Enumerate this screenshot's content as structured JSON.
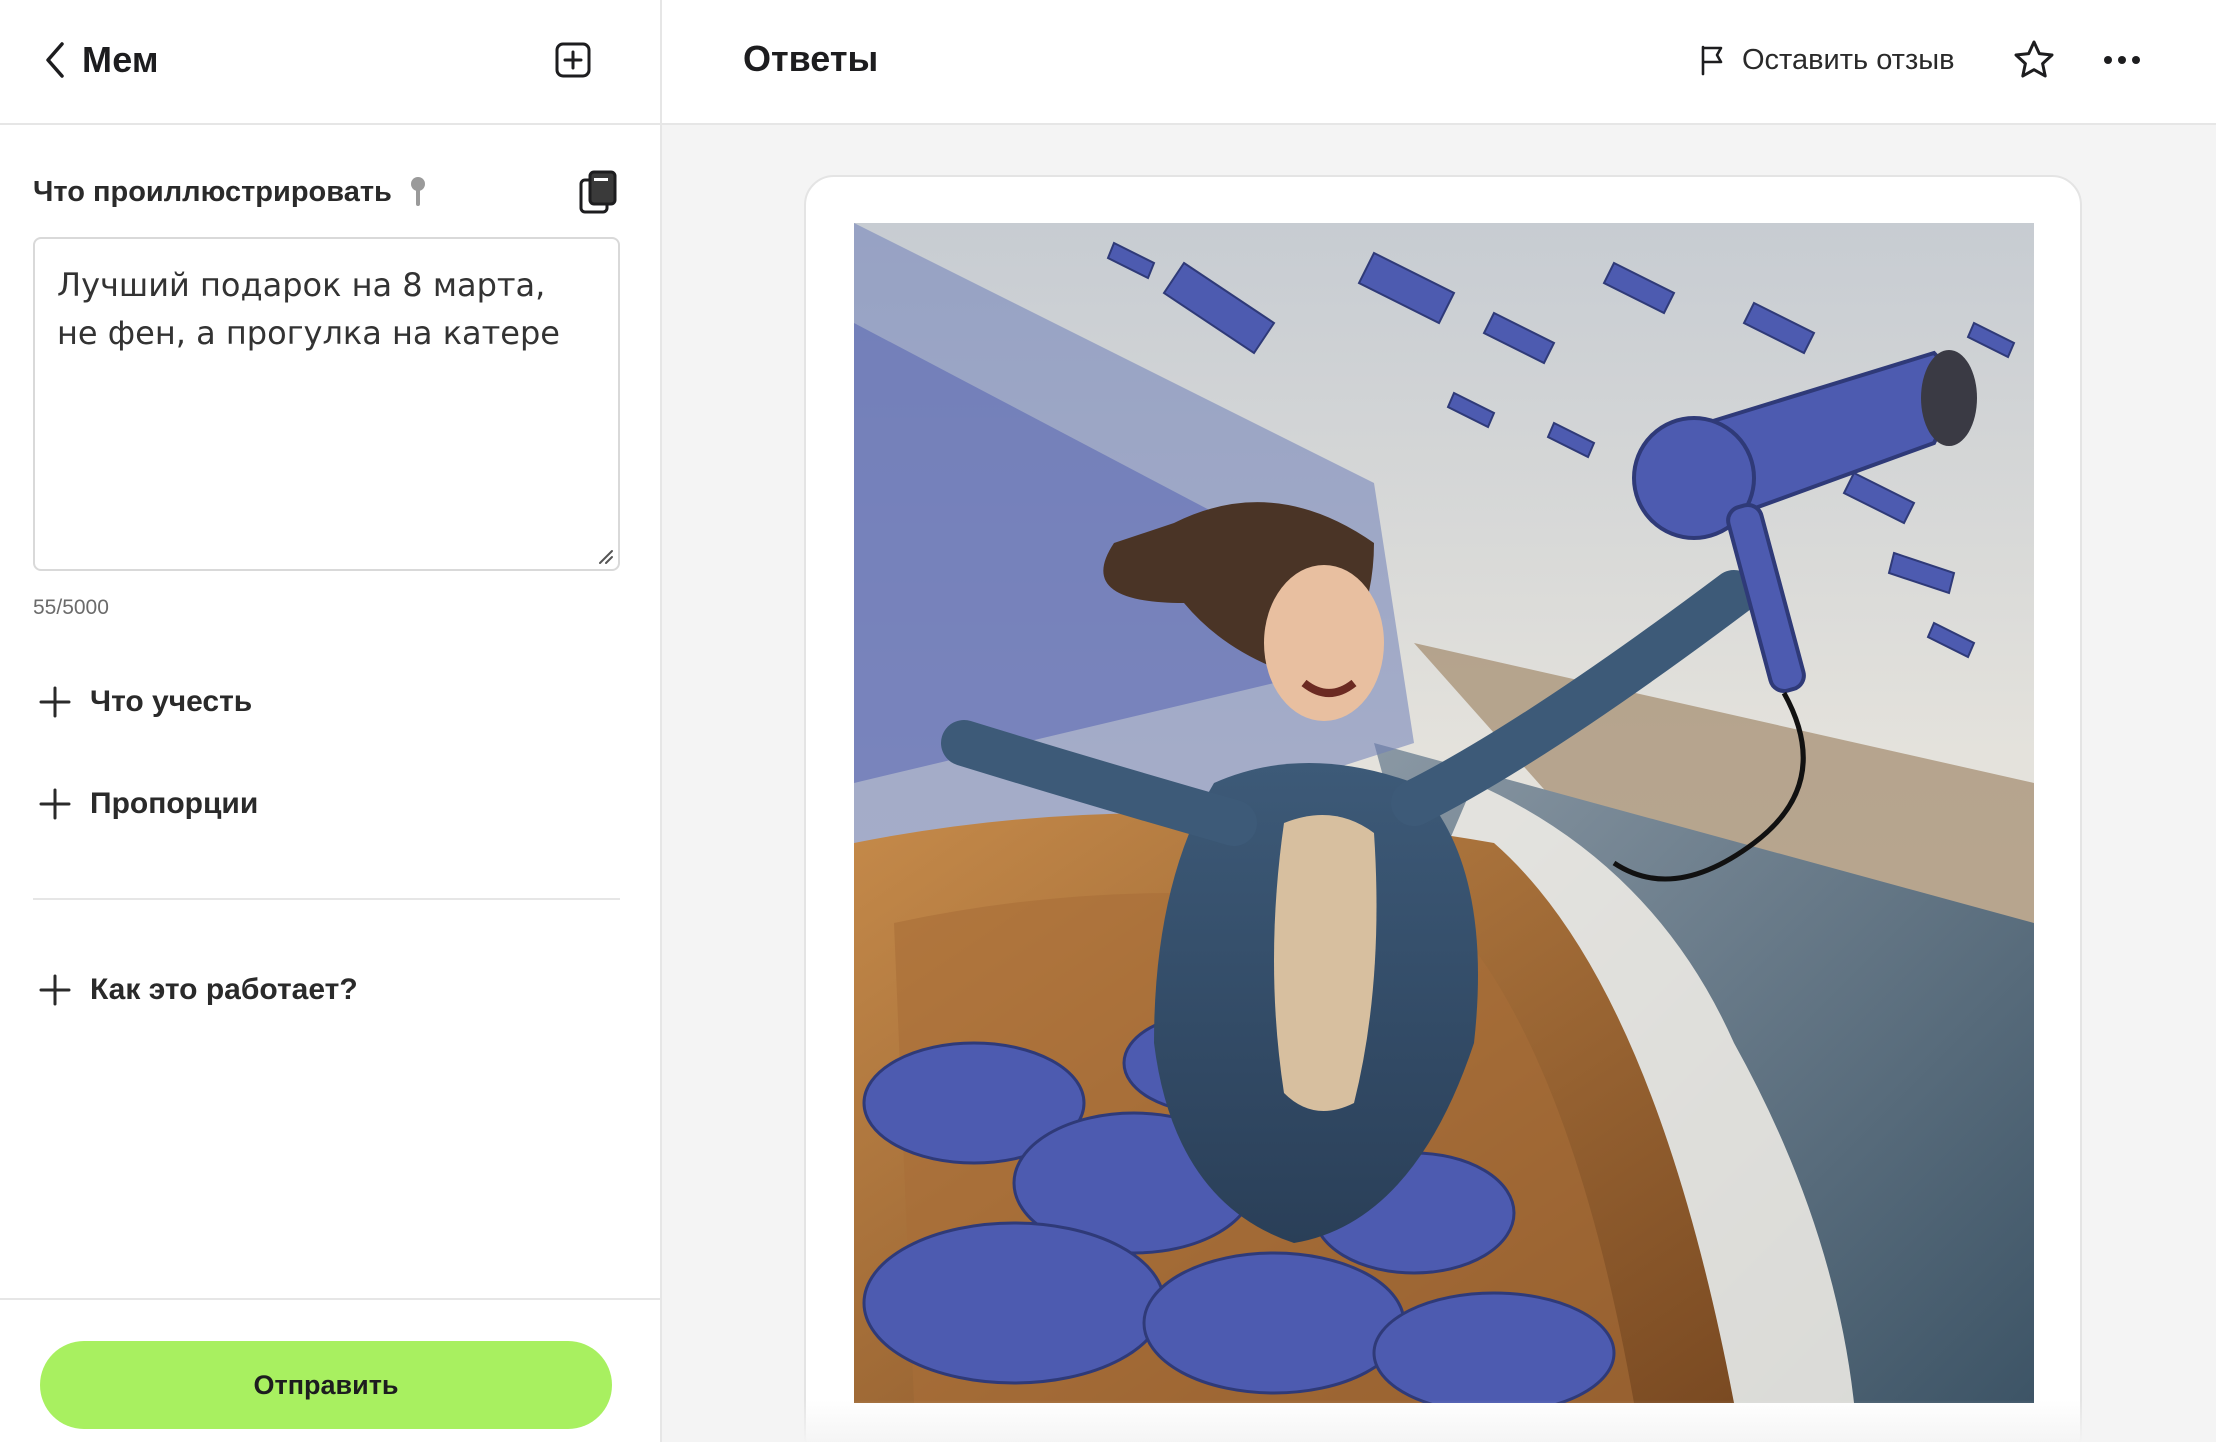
{
  "left": {
    "back_title": "Мем",
    "field_label": "Что проиллюстрировать",
    "prompt_value": "Лучший подарок на 8 марта, не фен, а прогулка на катере",
    "counter": "55/5000",
    "expanders": [
      "Что учесть",
      "Пропорции",
      "Как это работает?"
    ],
    "submit_label": "Отправить"
  },
  "right": {
    "title": "Ответы",
    "feedback_label": "Оставить отзыв"
  },
  "colors": {
    "accent": "#a8f060",
    "border": "#e6e6e6",
    "panel_bg": "#f4f4f4",
    "hairdryer": "#4d5bb0"
  },
  "icons": [
    "chevron-left-icon",
    "plus-square-icon",
    "pin-icon",
    "copy-icon",
    "plus-icon",
    "flag-icon",
    "star-icon",
    "more-icon"
  ]
}
